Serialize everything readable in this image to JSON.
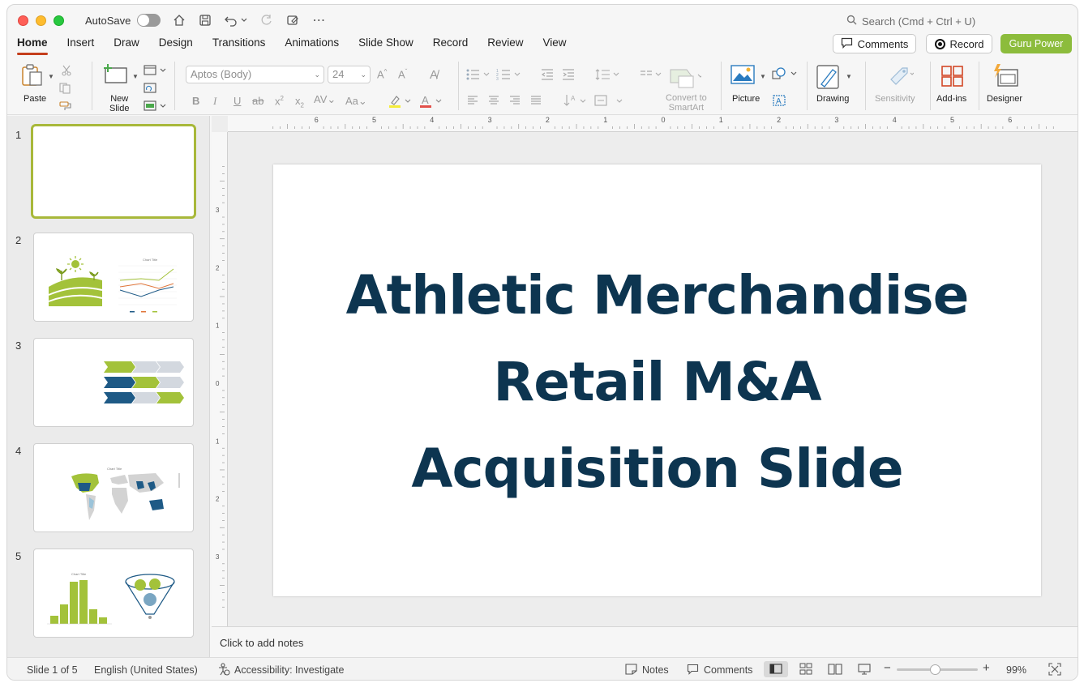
{
  "titlebar": {
    "autosave_label": "AutoSave",
    "search_placeholder": "Search (Cmd + Ctrl + U)"
  },
  "tabs": [
    "Home",
    "Insert",
    "Draw",
    "Design",
    "Transitions",
    "Animations",
    "Slide Show",
    "Record",
    "Review",
    "View"
  ],
  "active_tab": "Home",
  "header_buttons": {
    "comments": "Comments",
    "record": "Record",
    "guru": "Guru Power"
  },
  "ribbon": {
    "paste": "Paste",
    "new_slide": "New\nSlide",
    "font_name": "Aptos (Body)",
    "font_size": "24",
    "convert_smartart": "Convert to\nSmartArt",
    "picture": "Picture",
    "drawing": "Drawing",
    "sensitivity": "Sensitivity",
    "addins": "Add-ins",
    "designer": "Designer"
  },
  "thumbnails": [
    {
      "number": "1",
      "selected": true
    },
    {
      "number": "2",
      "selected": false,
      "chart_title": "Chart Title"
    },
    {
      "number": "3",
      "selected": false
    },
    {
      "number": "4",
      "selected": false,
      "chart_title": "Chart Title"
    },
    {
      "number": "5",
      "selected": false,
      "chart_title": "Chart Title"
    }
  ],
  "ruler": {
    "h_ticks": [
      "6",
      "5",
      "4",
      "3",
      "2",
      "1",
      "0",
      "1",
      "2",
      "3",
      "4",
      "5",
      "6"
    ],
    "v_ticks": [
      "3",
      "2",
      "1",
      "0",
      "1",
      "2",
      "3"
    ]
  },
  "slide": {
    "title_lines": [
      "Athletic Merchandise",
      "Retail M&A",
      "Acquisition Slide"
    ]
  },
  "notes_placeholder": "Click to add notes",
  "status": {
    "slide_counter": "Slide 1 of 5",
    "language": "English (United States)",
    "accessibility": "Accessibility: Investigate",
    "notes": "Notes",
    "comments": "Comments",
    "zoom": "99%"
  },
  "colors": {
    "accent_tab": "#c43e1c",
    "brand_green": "#8cbc3c",
    "slide_title": "#0d3550",
    "thumb_green": "#a3c23a",
    "thumb_navy": "#1e5a86"
  }
}
